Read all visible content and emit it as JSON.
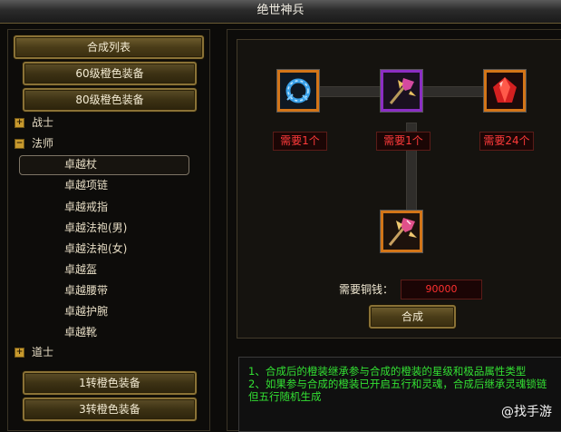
{
  "window": {
    "title": "绝世神兵"
  },
  "left_panel": {
    "header_button": "合成列表",
    "top_groups": [
      "60级橙色装备",
      "80级橙色装备"
    ],
    "classes": [
      {
        "label": "战士",
        "expanded": false
      },
      {
        "label": "法师",
        "expanded": true
      },
      {
        "label": "道士",
        "expanded": false
      }
    ],
    "mage_items": [
      "卓越杖",
      "卓越项链",
      "卓越戒指",
      "卓越法袍(男)",
      "卓越法袍(女)",
      "卓越盔",
      "卓越腰带",
      "卓越护腕",
      "卓越靴"
    ],
    "selected_item": "卓越杖",
    "bottom_groups": [
      "1转橙色装备",
      "3转橙色装备"
    ]
  },
  "craft": {
    "materials": [
      {
        "icon": "blue-ring-icon",
        "requirement": "需要1个",
        "rarity": "orange"
      },
      {
        "icon": "purple-staff-icon",
        "requirement": "需要1个",
        "rarity": "purple"
      },
      {
        "icon": "red-gem-icon",
        "requirement": "需要24个",
        "rarity": "orange"
      }
    ],
    "result": {
      "icon": "result-staff-icon",
      "rarity": "orange"
    },
    "cost_label": "需要铜钱：",
    "cost_value": "90000",
    "craft_button": "合成"
  },
  "description": {
    "lines": [
      "1、合成后的橙装继承参与合成的橙装的星级和极品属性类型",
      "2、如果参与合成的橙装已开启五行和灵魂，合成后继承灵魂锁链但五行随机生成"
    ]
  },
  "watermark": "@找手游",
  "colors": {
    "gold": "#c89a2e",
    "requirement_red": "#ff3a3a",
    "info_green": "#33e033"
  }
}
